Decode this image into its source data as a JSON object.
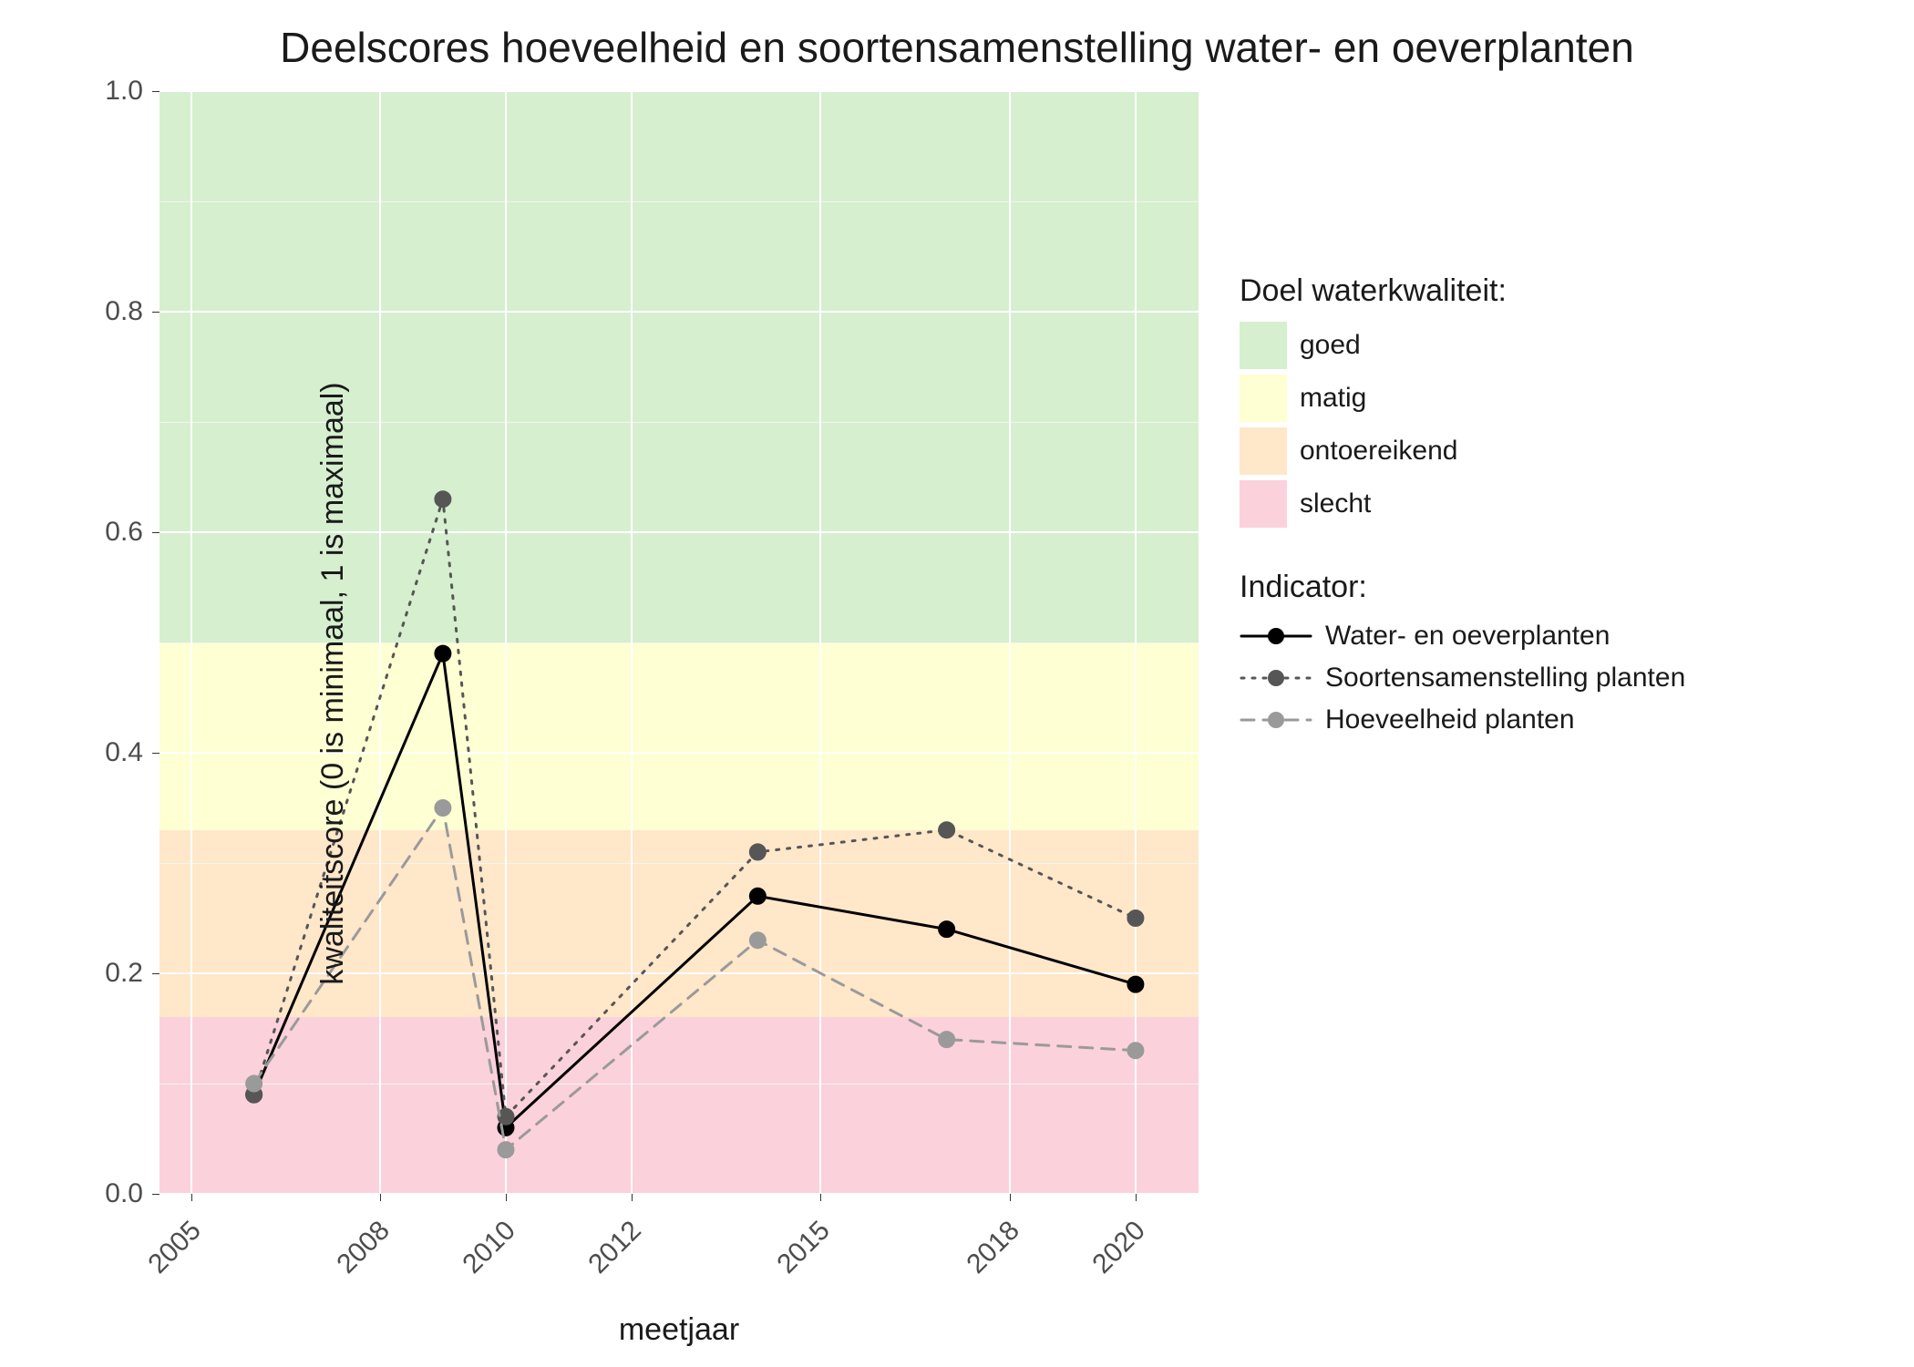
{
  "chart_data": {
    "type": "line",
    "title": "Deelscores hoeveelheid en soortensamenstelling water- en oeverplanten",
    "xlabel": "meetjaar",
    "ylabel": "kwaliteitscore (0 is minimaal, 1 is maximaal)",
    "x_ticks": [
      2005,
      2008,
      2010,
      2012,
      2015,
      2018,
      2020
    ],
    "y_ticks": [
      0.0,
      0.2,
      0.4,
      0.6,
      0.8,
      1.0
    ],
    "xlim": [
      2004.5,
      2021
    ],
    "ylim": [
      0.0,
      1.0
    ],
    "bands": {
      "title": "Doel waterkwaliteit:",
      "levels": [
        {
          "label": "goed",
          "from": 0.5,
          "to": 1.0,
          "color": "#d6efce"
        },
        {
          "label": "matig",
          "from": 0.33,
          "to": 0.5,
          "color": "#feffd3"
        },
        {
          "label": "ontoereikend",
          "from": 0.16,
          "to": 0.33,
          "color": "#ffe7c9"
        },
        {
          "label": "slecht",
          "from": 0.0,
          "to": 0.16,
          "color": "#fbd1dc"
        }
      ]
    },
    "series_title": "Indicator:",
    "series": [
      {
        "name": "Water- en oeverplanten",
        "line": "solid",
        "color": "#000000",
        "point_fill": "#000000",
        "x": [
          2006,
          2009,
          2010,
          2014,
          2017,
          2020
        ],
        "y": [
          0.09,
          0.49,
          0.06,
          0.27,
          0.24,
          0.19
        ]
      },
      {
        "name": "Soortensamenstelling planten",
        "line": "dotted",
        "color": "#565656",
        "point_fill": "#565656",
        "x": [
          2006,
          2009,
          2010,
          2014,
          2017,
          2020
        ],
        "y": [
          0.09,
          0.63,
          0.07,
          0.31,
          0.33,
          0.25
        ]
      },
      {
        "name": "Hoeveelheid planten",
        "line": "dashed",
        "color": "#9a9a9a",
        "point_fill": "#9a9a9a",
        "x": [
          2006,
          2009,
          2010,
          2014,
          2017,
          2020
        ],
        "y": [
          0.1,
          0.35,
          0.04,
          0.23,
          0.14,
          0.13
        ]
      }
    ]
  }
}
